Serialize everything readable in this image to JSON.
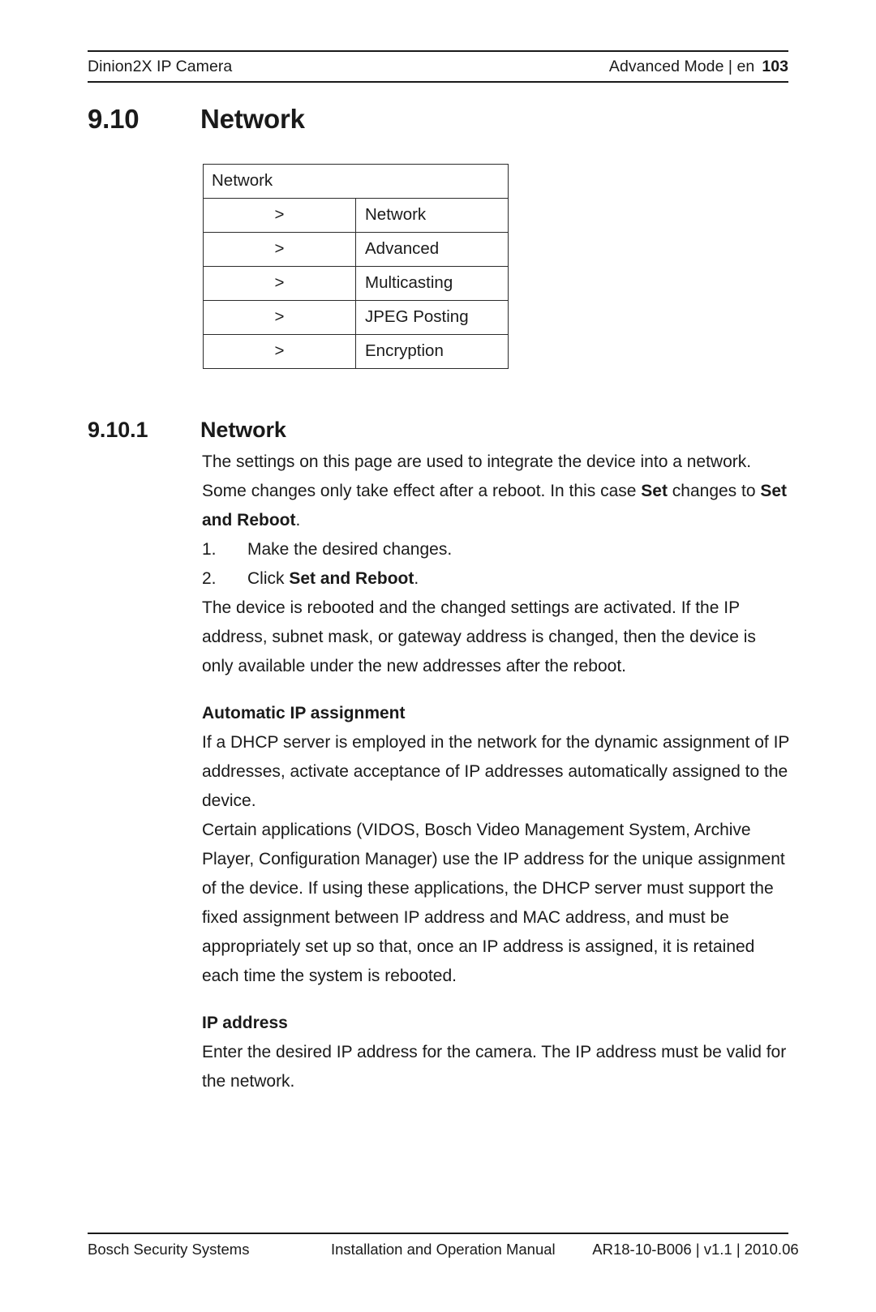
{
  "header": {
    "left": "Dinion2X IP Camera",
    "right": "Advanced Mode | en",
    "page_number": "103"
  },
  "chapter": {
    "number": "9.10",
    "title": "Network"
  },
  "nav_table": {
    "header": "Network",
    "arrow": ">",
    "rows": [
      {
        "arrow": ">",
        "label": "Network"
      },
      {
        "arrow": ">",
        "label": "Advanced"
      },
      {
        "arrow": ">",
        "label": "Multicasting"
      },
      {
        "arrow": ">",
        "label": "JPEG Posting"
      },
      {
        "arrow": ">",
        "label": "Encryption"
      }
    ]
  },
  "section": {
    "number": "9.10.1",
    "title": "Network",
    "intro_a": "The settings on this page are used to integrate the device into a network. Some changes only take effect after a reboot. In this case ",
    "intro_bold_1": "Set",
    "intro_b": " changes to ",
    "intro_bold_2": "Set and Reboot",
    "intro_c": ".",
    "steps": [
      {
        "num": "1.",
        "text": "Make the desired changes.",
        "text_pre": "Make the desired changes.",
        "bold": "",
        "text_post": ""
      },
      {
        "num": "2.",
        "text": "Click Set and Reboot.",
        "text_pre": "Click ",
        "bold": "Set and Reboot",
        "text_post": "."
      }
    ],
    "after_steps": "The device is rebooted and the changed settings are activated. If the IP address, subnet mask, or gateway address is changed, then the device is only available under the new addresses after the reboot.",
    "auto_ip_heading": "Automatic IP assignment",
    "auto_ip_para_1": "If a DHCP server is employed in the network for the dynamic assignment of IP addresses, activate acceptance of IP addresses automatically assigned to the device.",
    "auto_ip_para_2": "Certain applications (VIDOS, Bosch Video Management System, Archive Player, Configuration Manager) use the IP address for the unique assignment of the device. If using these applications, the DHCP server must support the fixed assignment between IP address and MAC address, and must be appropriately set up so that, once an IP address is assigned, it is retained each time the system is rebooted.",
    "ip_address_heading": "IP address",
    "ip_address_para": "Enter the desired IP address for the camera. The IP address must be valid for the network."
  },
  "footer": {
    "left": "Bosch Security Systems",
    "center": "Installation and Operation Manual",
    "right": "AR18-10-B006 | v1.1 | 2010.06"
  }
}
